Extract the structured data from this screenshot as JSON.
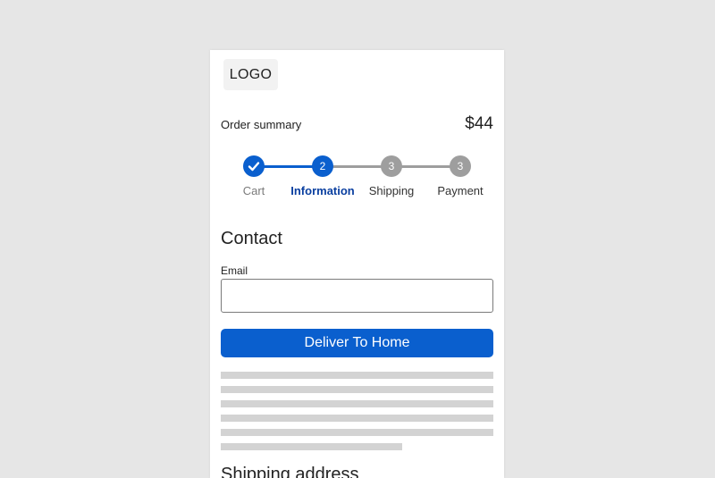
{
  "colors": {
    "accent": "#0a5fce",
    "accent_text": "#0a3fa0",
    "inactive": "#9e9e9e",
    "muted_text": "#7a7a7a",
    "text": "#333333",
    "skeleton": "#d3d3d3"
  },
  "header": {
    "logo": "LOGO"
  },
  "summary": {
    "label": "Order summary",
    "total": "$44"
  },
  "stepper": {
    "steps": [
      {
        "number": "",
        "label": "Cart",
        "state": "completed",
        "icon": "check-icon"
      },
      {
        "number": "2",
        "label": "Information",
        "state": "active"
      },
      {
        "number": "3",
        "label": "Shipping",
        "state": "upcoming"
      },
      {
        "number": "3",
        "label": "Payment",
        "state": "upcoming"
      }
    ]
  },
  "contact": {
    "title": "Contact",
    "email_label": "Email",
    "email_value": "",
    "email_placeholder": ""
  },
  "actions": {
    "deliver_label": "Deliver To Home"
  },
  "shipping": {
    "title": "Shipping address"
  }
}
